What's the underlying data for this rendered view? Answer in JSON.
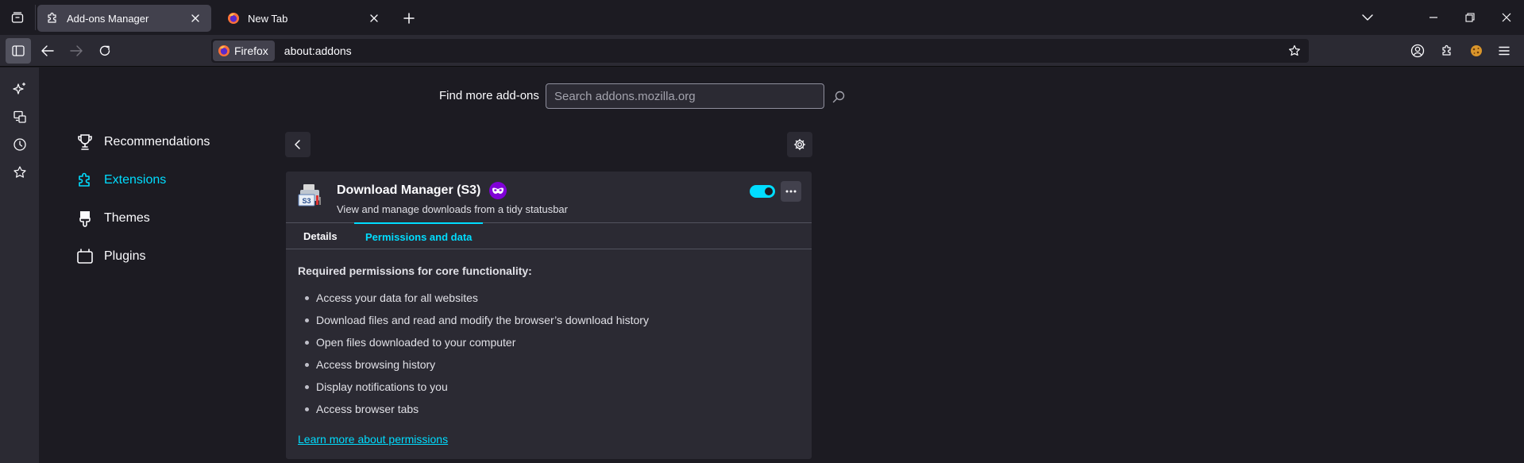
{
  "tabs": [
    {
      "title": "Add-ons Manager",
      "active": true,
      "icon": "puzzle-icon"
    },
    {
      "title": "New Tab",
      "active": false,
      "icon": "firefox-icon"
    }
  ],
  "urlbar": {
    "identity_label": "Firefox",
    "url": "about:addons"
  },
  "search": {
    "label": "Find more add-ons",
    "placeholder": "Search addons.mozilla.org"
  },
  "categories": [
    {
      "label": "Recommendations",
      "icon": "trophy-icon",
      "selected": false
    },
    {
      "label": "Extensions",
      "icon": "puzzle-icon",
      "selected": true
    },
    {
      "label": "Themes",
      "icon": "brush-icon",
      "selected": false
    },
    {
      "label": "Plugins",
      "icon": "plugin-icon",
      "selected": false
    }
  ],
  "addon": {
    "name": "Download Manager (S3)",
    "description": "View and manage downloads from a tidy statusbar",
    "enabled": true,
    "icon_label": "S3",
    "tabs": {
      "details": "Details",
      "permissions": "Permissions and data"
    },
    "required_title": "Required permissions for core functionality:",
    "permissions": [
      "Access your data for all websites",
      "Download files and read and modify the browser’s download history",
      "Open files downloaded to your computer",
      "Access browsing history",
      "Display notifications to you",
      "Access browser tabs"
    ],
    "learn_more": "Learn more about permissions"
  },
  "colors": {
    "accent": "#00ddff",
    "background": "#1c1b22",
    "toolbar": "#2b2a33",
    "badge": "#8000d7"
  }
}
